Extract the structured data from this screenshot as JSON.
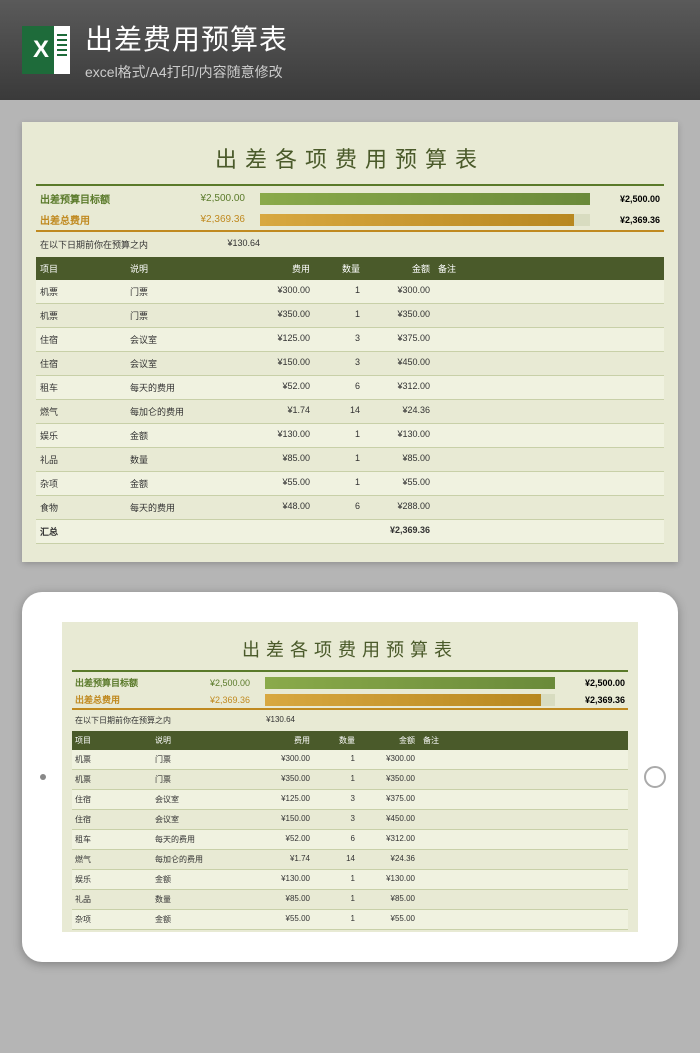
{
  "banner": {
    "title": "出差费用预算表",
    "subtitle": "excel格式/A4打印/内容随意修改"
  },
  "sheet": {
    "title": "出差各项费用预算表",
    "target": {
      "label": "出差预算目标额",
      "value": "¥2,500.00",
      "bar_value": "¥2,500.00"
    },
    "total": {
      "label": "出差总费用",
      "value": "¥2,369.36",
      "bar_value": "¥2,369.36"
    },
    "remain": {
      "label": "在以下日期前你在预算之内",
      "value": "¥130.64"
    },
    "columns": {
      "c1": "项目",
      "c2": "说明",
      "c3": "费用",
      "c4": "数量",
      "c5": "金额",
      "c6": "备注"
    },
    "rows": [
      {
        "c1": "机票",
        "c2": "门票",
        "c3": "¥300.00",
        "c4": "1",
        "c5": "¥300.00"
      },
      {
        "c1": "机票",
        "c2": "门票",
        "c3": "¥350.00",
        "c4": "1",
        "c5": "¥350.00"
      },
      {
        "c1": "住宿",
        "c2": "会议室",
        "c3": "¥125.00",
        "c4": "3",
        "c5": "¥375.00"
      },
      {
        "c1": "住宿",
        "c2": "会议室",
        "c3": "¥150.00",
        "c4": "3",
        "c5": "¥450.00"
      },
      {
        "c1": "租车",
        "c2": "每天的费用",
        "c3": "¥52.00",
        "c4": "6",
        "c5": "¥312.00"
      },
      {
        "c1": "燃气",
        "c2": "每加仑的费用",
        "c3": "¥1.74",
        "c4": "14",
        "c5": "¥24.36"
      },
      {
        "c1": "娱乐",
        "c2": "金额",
        "c3": "¥130.00",
        "c4": "1",
        "c5": "¥130.00"
      },
      {
        "c1": "礼品",
        "c2": "数量",
        "c3": "¥85.00",
        "c4": "1",
        "c5": "¥85.00"
      },
      {
        "c1": "杂项",
        "c2": "金额",
        "c3": "¥55.00",
        "c4": "1",
        "c5": "¥55.00"
      },
      {
        "c1": "食物",
        "c2": "每天的费用",
        "c3": "¥48.00",
        "c4": "6",
        "c5": "¥288.00"
      }
    ],
    "total_row": {
      "c1": "汇总",
      "c5": "¥2,369.36"
    }
  },
  "chart_data": {
    "type": "bar",
    "categories": [
      "出差预算目标额",
      "出差总费用"
    ],
    "values": [
      2500.0,
      2369.36
    ],
    "title": "出差各项费用预算表",
    "xlabel": "",
    "ylabel": "¥",
    "ylim": [
      0,
      2500
    ]
  }
}
